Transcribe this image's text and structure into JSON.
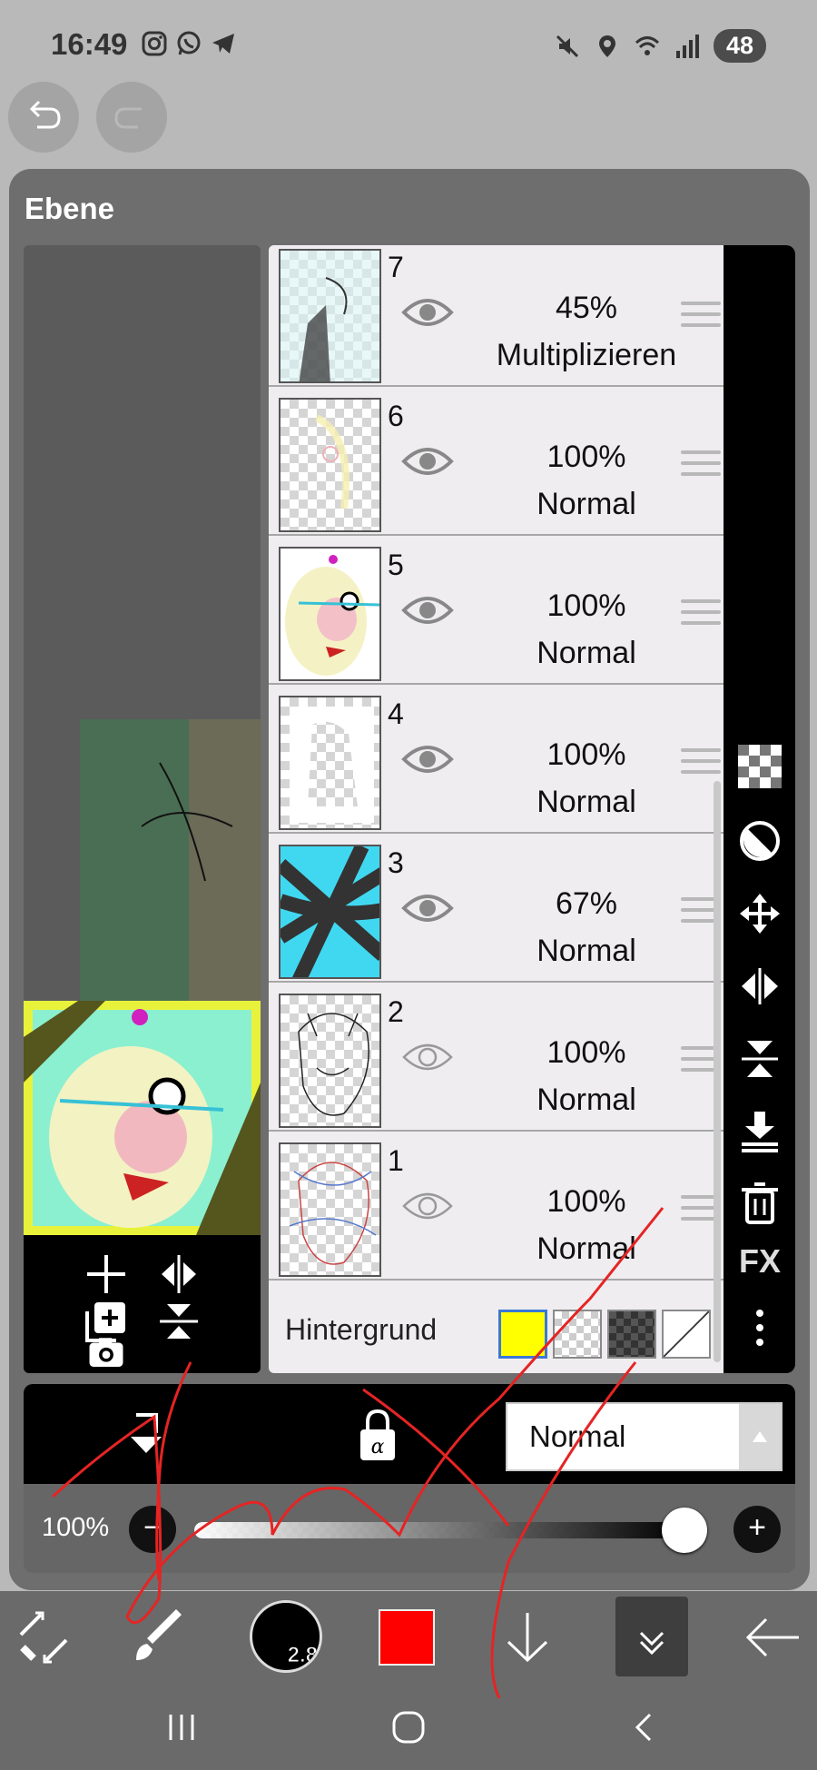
{
  "status_bar": {
    "time": "16:49",
    "battery": "48",
    "app_icons": [
      "instagram-icon",
      "whatsapp-icon",
      "telegram-icon"
    ],
    "system_icons": [
      "mute-icon",
      "location-icon",
      "wifi-icon",
      "signal-icon"
    ]
  },
  "dialog": {
    "title": "Ebene"
  },
  "layers": [
    {
      "number": "7",
      "opacity": "45%",
      "blend_mode": "Multiplizieren",
      "visible": true
    },
    {
      "number": "6",
      "opacity": "100%",
      "blend_mode": "Normal",
      "visible": true
    },
    {
      "number": "5",
      "opacity": "100%",
      "blend_mode": "Normal",
      "visible": true
    },
    {
      "number": "4",
      "opacity": "100%",
      "blend_mode": "Normal",
      "visible": true
    },
    {
      "number": "3",
      "opacity": "67%",
      "blend_mode": "Normal",
      "visible": true
    },
    {
      "number": "2",
      "opacity": "100%",
      "blend_mode": "Normal",
      "visible": false
    },
    {
      "number": "1",
      "opacity": "100%",
      "blend_mode": "Normal",
      "visible": false
    }
  ],
  "background": {
    "label": "Hintergrund",
    "swatches": [
      "yellow",
      "transparent",
      "dark-checker",
      "none"
    ],
    "selected": "yellow"
  },
  "side_toolbar": {
    "icons": [
      "checker-icon",
      "invert-icon",
      "move-icon",
      "flip-horizontal-icon",
      "flip-vertical-icon",
      "merge-down-icon",
      "trash-icon",
      "fx-label",
      "more-icon"
    ],
    "fx_label": "FX"
  },
  "mode_bar": {
    "blend_mode": "Normal",
    "opacity_label": "100%",
    "opacity_value": 1.0,
    "minus": "−",
    "plus": "+"
  },
  "app_toolbar": {
    "brush_size": "2.8",
    "current_color": "#ff0000"
  },
  "colors": {
    "accent_selection": "#3a78d6",
    "dialog_bg": "#6e6e6e"
  }
}
